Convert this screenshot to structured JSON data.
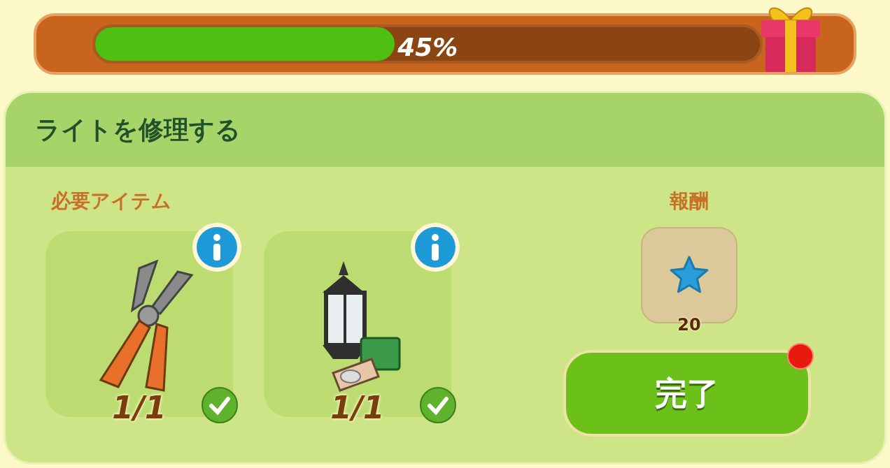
{
  "progress": {
    "level": 0.45,
    "reading": "45%"
  },
  "task": {
    "title": "ライトを修理する"
  },
  "required": {
    "heading": "必要アイテム",
    "items": [
      {
        "kind": "pliers",
        "count": "1/1",
        "checked": true
      },
      {
        "kind": "lantern",
        "count": "1/1",
        "checked": true
      }
    ]
  },
  "reward": {
    "heading": "報酬",
    "amount": "20"
  },
  "complete_button": {
    "label": "完了",
    "notification": true
  }
}
